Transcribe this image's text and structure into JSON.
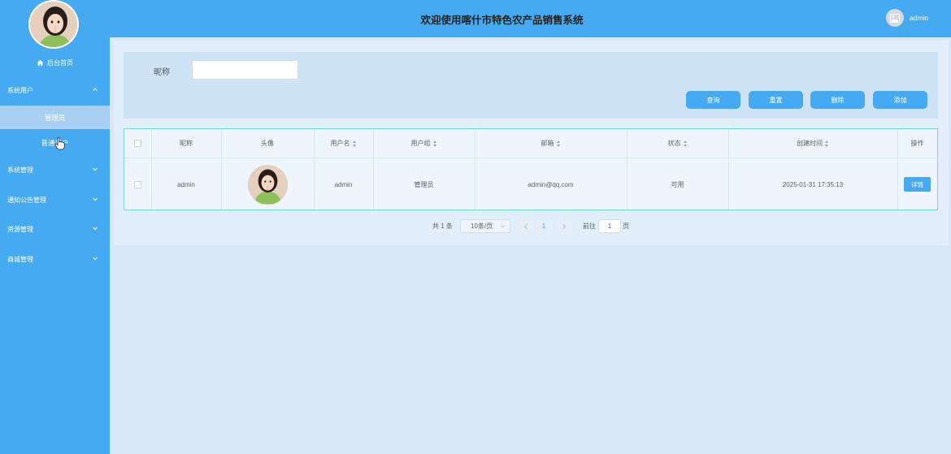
{
  "header": {
    "title": "欢迎使用喀什市特色农产品销售系统",
    "username": "admin"
  },
  "sidebar": {
    "home": "后台首页",
    "groups": [
      {
        "label": "系统用户",
        "sub": [
          "管理员",
          "普通用户"
        ]
      },
      {
        "label": "系统管理"
      },
      {
        "label": "通知公告管理"
      },
      {
        "label": "资源管理"
      },
      {
        "label": "商城管理"
      }
    ]
  },
  "search": {
    "label": "昵称",
    "value": "",
    "placeholder": ""
  },
  "buttons": {
    "query": "查询",
    "reset": "重置",
    "delete": "删除",
    "add": "添加"
  },
  "table": {
    "headers": {
      "nickname": "昵称",
      "avatar": "头像",
      "username": "用户名",
      "group": "用户组",
      "email": "邮箱",
      "status": "状态",
      "created": "创建时间",
      "actions": "操作"
    },
    "rows": [
      {
        "nickname": "admin",
        "username": "admin",
        "group": "管理员",
        "email": "admin@qq.com",
        "status": "可用",
        "created": "2025-01-31 17:35:13",
        "action": "详情"
      }
    ]
  },
  "pagination": {
    "total": "共 1 条",
    "page_size": "10条/页",
    "current_page": "1",
    "goto": "前往",
    "goto_value": "1",
    "page_word": "页"
  },
  "colors": {
    "primary": "#45aaf0",
    "active_item": "#a9cff3",
    "background": "#dbeaf8"
  }
}
